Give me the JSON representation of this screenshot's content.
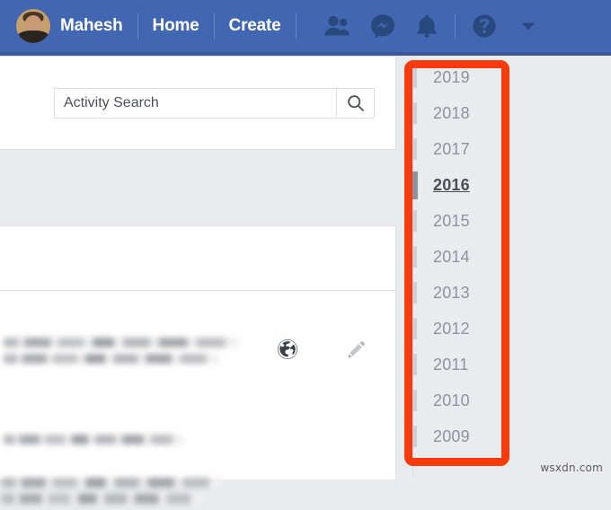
{
  "topbar": {
    "profile_name": "Mahesh",
    "avatar_alt": "profile-photo",
    "links": [
      {
        "label": "Home",
        "name": "nav-link-home"
      },
      {
        "label": "Create",
        "name": "nav-link-create"
      }
    ],
    "icons": [
      {
        "name": "friend-requests-icon",
        "glyph": "friends"
      },
      {
        "name": "messenger-icon",
        "glyph": "messenger"
      },
      {
        "name": "notifications-icon",
        "glyph": "bell"
      },
      {
        "name": "help-icon",
        "glyph": "question-circle"
      },
      {
        "name": "account-dropdown-icon",
        "glyph": "caret-down"
      }
    ],
    "background_color": "#4267b2",
    "icon_color": "#29487d"
  },
  "search": {
    "value": "Activity Search",
    "placeholder": "Activity Search",
    "button_name": "search-button",
    "icon": "search-icon"
  },
  "post": {
    "privacy_icon": "globe-icon",
    "edit_icon": "pencil-icon",
    "blurred_text_rows": 3
  },
  "year_filter": {
    "selected": "2016",
    "years": [
      "2019",
      "2018",
      "2017",
      "2016",
      "2015",
      "2014",
      "2013",
      "2012",
      "2011",
      "2010",
      "2009"
    ],
    "highlight_color": "#f93a0b",
    "text_color": "#8d949e",
    "selected_text_color": "#4b4f56"
  },
  "watermark": {
    "text": "wsxdn.com"
  }
}
